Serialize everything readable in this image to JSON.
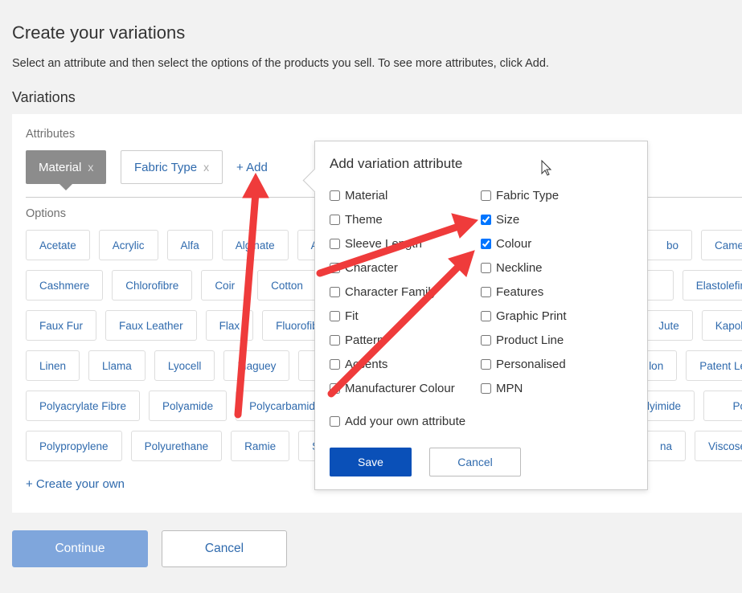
{
  "page": {
    "title": "Create your variations",
    "subtitle": "Select an attribute and then select the options of the products you sell. To see more attributes, click Add.",
    "section": "Variations"
  },
  "attributes": {
    "label": "Attributes",
    "selected": "Material",
    "other": "Fabric Type",
    "remove": "x",
    "add": "+ Add"
  },
  "options": {
    "label": "Options",
    "rows": [
      [
        "Acetate",
        "Acrylic",
        "Alfa",
        "Alginate",
        "A"
      ],
      [
        "Cashmere",
        "Chlorofibre",
        "Coir",
        "Cotton"
      ],
      [
        "Faux Fur",
        "Faux Leather",
        "Flax",
        "Fluorofib"
      ],
      [
        "Linen",
        "Llama",
        "Lyocell",
        "Maguey",
        ""
      ],
      [
        "Polyacrylate Fibre",
        "Polyamide",
        "Polycarbamide"
      ],
      [
        "Polypropylene",
        "Polyurethane",
        "Ramie",
        "S"
      ]
    ],
    "right_rows": [
      [
        "bo",
        "Camel"
      ],
      [
        "",
        "Elastolefin"
      ],
      [
        "Jute",
        "Kapok"
      ],
      [
        "lon",
        "Patent Le"
      ],
      [
        "Polyimide",
        "Po"
      ],
      [
        "na",
        "Viscose"
      ]
    ],
    "create_own": "+ Create your own"
  },
  "footer": {
    "continue": "Continue",
    "cancel": "Cancel"
  },
  "popup": {
    "title": "Add variation attribute",
    "left": [
      {
        "label": "Material",
        "checked": false
      },
      {
        "label": "Theme",
        "checked": false
      },
      {
        "label": "Sleeve Length",
        "checked": false
      },
      {
        "label": "Character",
        "checked": false
      },
      {
        "label": "Character Family",
        "checked": false
      },
      {
        "label": "Fit",
        "checked": false
      },
      {
        "label": "Pattern",
        "checked": false
      },
      {
        "label": "Accents",
        "checked": false
      },
      {
        "label": "Manufacturer Colour",
        "checked": false
      }
    ],
    "right": [
      {
        "label": "Fabric Type",
        "checked": false
      },
      {
        "label": "Size",
        "checked": true
      },
      {
        "label": "Colour",
        "checked": true
      },
      {
        "label": "Neckline",
        "checked": false
      },
      {
        "label": "Features",
        "checked": false
      },
      {
        "label": "Graphic Print",
        "checked": false
      },
      {
        "label": "Product Line",
        "checked": false
      },
      {
        "label": "Personalised",
        "checked": false
      },
      {
        "label": "MPN",
        "checked": false
      }
    ],
    "own": "Add your own attribute",
    "save": "Save",
    "cancel": "Cancel"
  },
  "colors": {
    "accent": "#0a50b8",
    "link": "#2f6aad",
    "annotation_arrow": "#ef3b3b"
  }
}
